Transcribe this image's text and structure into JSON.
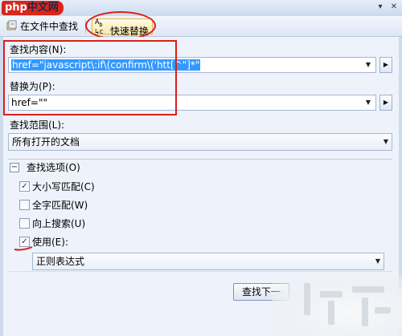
{
  "window": {
    "logo": {
      "prefix": "php",
      "suffix": "中文网"
    },
    "title_buttons": [
      "▾",
      "✕"
    ]
  },
  "toolbar": {
    "find_in_files": "在文件中查找",
    "quick_replace": "快速替换",
    "dropdown_glyph": "▾"
  },
  "find": {
    "label": "查找内容(N):",
    "value": "href=\"javascript\\:if\\(confirm\\('htt[^\"]*\""
  },
  "replace": {
    "label": "替换为(P):",
    "value": "href=\"\""
  },
  "scope": {
    "label": "查找范围(L):",
    "selected": "所有打开的文档"
  },
  "options": {
    "section_label": "查找选项(O)",
    "collapse_glyph": "−",
    "match_case": {
      "label": "大小写匹配(C)",
      "checked": true
    },
    "whole_word": {
      "label": "全字匹配(W)",
      "checked": false
    },
    "search_up": {
      "label": "向上搜索(U)",
      "checked": false
    },
    "use": {
      "label": "使用(E):",
      "checked": true
    },
    "use_mode": "正则表达式"
  },
  "buttons": {
    "find_next": "查找下一"
  },
  "colors": {
    "annotation_red": "#d81e1e",
    "selection_blue": "#3399ff",
    "panel_bg": "#eef3fb"
  }
}
